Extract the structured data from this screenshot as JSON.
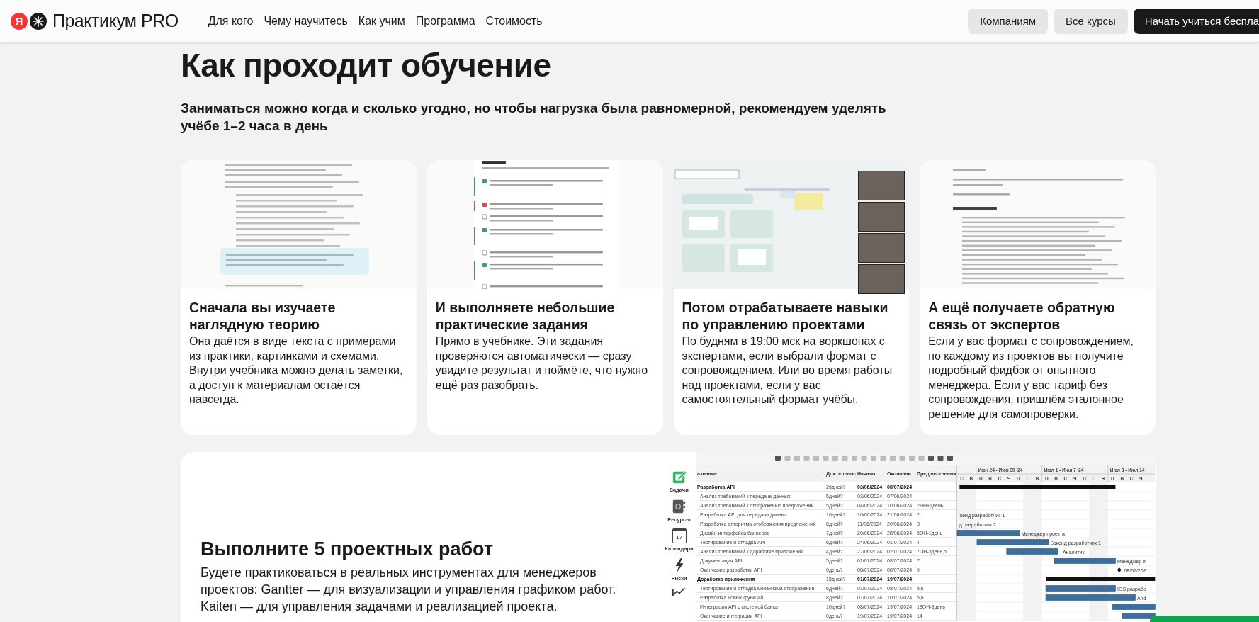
{
  "header": {
    "logo_letter": "Я",
    "brand": "Практикум PRO",
    "nav": [
      {
        "label": "Для кого"
      },
      {
        "label": "Чему научитесь"
      },
      {
        "label": "Как учим"
      },
      {
        "label": "Программа"
      },
      {
        "label": "Стоимость"
      }
    ],
    "buttons": [
      {
        "label": "Компаниям",
        "kind": "secondary"
      },
      {
        "label": "Все курсы",
        "kind": "secondary"
      },
      {
        "label": "Начать учиться беспла",
        "kind": "primary"
      }
    ]
  },
  "intro": {
    "title": "Как проходит обучение",
    "subtitle": "Заниматься можно когда и сколько угодно, но чтобы нагрузка была равномерной, рекомендуем уделять учёбе 1–2 часа в день"
  },
  "cards": [
    {
      "kind": "document",
      "title": "Сначала вы изучаете наглядную теорию",
      "text": "Она даётся в виде текста с примерами из практики, картинками и схемами. Внутри учебника можно делать заметки, а доступ к материалам остаётся навсегда."
    },
    {
      "kind": "quiz",
      "title": "И выполняете небольшие практические задания",
      "text": "Прямо в учебнике. Эти задания проверяются автоматически — сразу увидите результат и поймёте, что нужно ещё раз разобрать."
    },
    {
      "kind": "video-call",
      "title": "Потом отрабатываете навыки по управлению проектами",
      "text": "По будням в 19:00 мск на воркшопах с экспертами, если выбрали формат с сопровождением. Или во время работы над проектами, если у вас самостоятельный формат учёбы."
    },
    {
      "kind": "feedback",
      "title": "А ещё получаете обратную связь от экспертов",
      "text": "Если у вас формат с сопровождением, по каждому из проектов вы получите подробный фидбэк от опытного менеджера. Если у вас тариф без сопровождения, пришлём эталонное решение для самопроверки."
    }
  ],
  "projects": {
    "title": "Выполните 5 проектных работ",
    "text": "Будете практиковаться в реальных инструментах для менеджеров проектов: Gantter — для визуализации и управления графиком работ. Kaiten — для управления задачами и реализацией проекта.",
    "gantt": {
      "sidebar": [
        {
          "label": "Задачи",
          "kind": "edit"
        },
        {
          "label": "Ресурсы",
          "kind": "contacts"
        },
        {
          "label": "Календари",
          "kind": "calendar",
          "number": "17"
        },
        {
          "label": "Риски",
          "kind": "risk"
        },
        {
          "kind": "chart"
        }
      ],
      "columns": [
        "азвание",
        "Длительнос",
        "Начало",
        "Окончани",
        "Предшественни"
      ],
      "rows": [
        {
          "kind": "group",
          "name": "Разработка API",
          "duration": "26дней?",
          "start": "03/06/2024",
          "end": "08/07/2024"
        },
        {
          "kind": "task",
          "name": "Анализ требований к передаче данных",
          "duration": "5дней?",
          "start": "03/06/2024",
          "end": "07/06/2024"
        },
        {
          "kind": "task",
          "name": "Анализ требований к отображению предложений",
          "duration": "5дней?",
          "start": "04/06/2024",
          "end": "10/06/2024",
          "predecessors": "2НН+1день"
        },
        {
          "kind": "task",
          "name": "Разработка API для передачи данных",
          "duration": "10дней?",
          "start": "10/06/2024",
          "end": "21/06/2024",
          "predecessors": "2"
        },
        {
          "kind": "task",
          "name": "Разработка алгоритма отображения предложений",
          "duration": "8дней?",
          "start": "11/06/2024",
          "end": "20/06/2024",
          "predecessors": "3"
        },
        {
          "kind": "task",
          "name": "Дизайн интерфейса баннеров",
          "duration": "7дней?",
          "start": "20/06/2024",
          "end": "28/06/2024",
          "predecessors": "5ОН-1день"
        },
        {
          "kind": "task",
          "name": "Тестирование и отладка API",
          "duration": "6дней?",
          "start": "24/06/2024",
          "end": "01/07/2024",
          "predecessors": "4"
        },
        {
          "kind": "task",
          "name": "Анализ требований к доработке приложений",
          "duration": "4дней?",
          "start": "27/06/2024",
          "end": "02/07/2024",
          "predecessors": "7ОН-3день,5"
        },
        {
          "kind": "task",
          "name": "Документация API",
          "duration": "5дней?",
          "start": "02/07/2024",
          "end": "08/07/2024",
          "predecessors": "7"
        },
        {
          "kind": "task",
          "name": "Окончание разработки API",
          "duration": "0день?",
          "start": "08/07/2024",
          "end": "08/07/2024",
          "predecessors": "9"
        },
        {
          "kind": "group",
          "name": "Доработка приложения",
          "duration": "15дней?",
          "start": "01/07/2024",
          "end": "19/07/2024"
        },
        {
          "kind": "task",
          "name": "Тестирование и отладка механизма отображения",
          "duration": "6дней?",
          "start": "01/07/2024",
          "end": "08/07/2024",
          "predecessors": "5,6"
        },
        {
          "kind": "task",
          "name": "Разработка новых функций",
          "duration": "8дней?",
          "start": "01/07/2024",
          "end": "10/07/2024",
          "predecessors": "5,6"
        },
        {
          "kind": "task",
          "name": "Интеграция API с системой банка",
          "duration": "10дней?",
          "start": "08/07/2024",
          "end": "19/07/2024",
          "predecessors": "13ОН-3день"
        },
        {
          "kind": "task",
          "name": "Окончание интеграции API",
          "duration": "0день?",
          "start": "19/07/2024",
          "end": "19/07/2024",
          "predecessors": "14"
        }
      ],
      "weeks": [
        "Июн 24 - Июн 30 '24",
        "Июл 1 - Июл 7 '24",
        "Июл 8 - Июл 14"
      ],
      "days": [
        "С",
        "В",
        "П",
        "В",
        "С",
        "Ч",
        "П",
        "С",
        "В",
        "П",
        "В",
        "С",
        "Ч",
        "П",
        "С",
        "В",
        "П",
        "В",
        "С",
        "Ч"
      ],
      "bar_labels": [
        "кенд разработчик 1",
        "д разработчик 2",
        "Менеджер проекта",
        "Бэкенд разработчик 1",
        "Аналитик",
        "Менеджер п",
        "08/07/202",
        "IOS разрабо",
        "And"
      ]
    }
  }
}
